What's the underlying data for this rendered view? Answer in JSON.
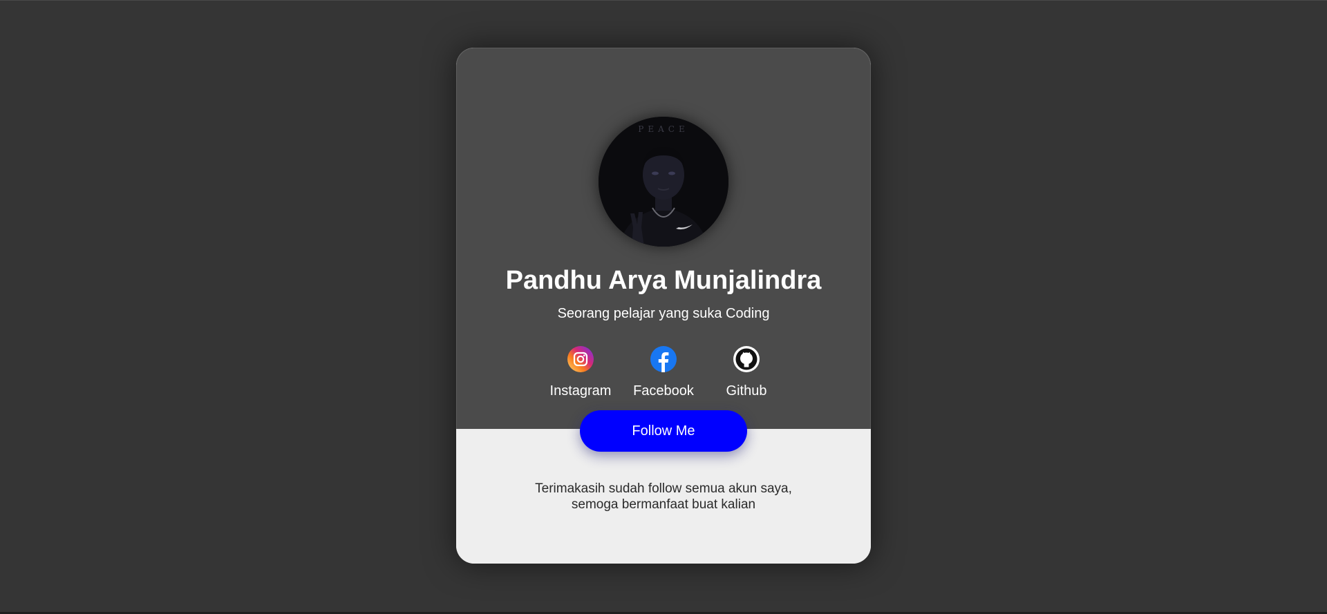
{
  "profile": {
    "name": "Pandhu Arya Munjalindra",
    "bio": "Seorang pelajar yang suka Coding",
    "avatar_text": "PEACE"
  },
  "socials": [
    {
      "label": "Instagram",
      "icon": "instagram-icon"
    },
    {
      "label": "Facebook",
      "icon": "facebook-icon"
    },
    {
      "label": "Github",
      "icon": "github-icon"
    }
  ],
  "follow_button": {
    "label": "Follow Me"
  },
  "message": {
    "line1": "Terimakasih sudah follow semua akun saya,",
    "line2": "semoga bermanfaat buat kalian"
  },
  "colors": {
    "background": "#353535",
    "card_top": "#4b4b4b",
    "card_bottom": "#eeeeee",
    "accent": "#0000ff",
    "facebook": "#1877f2"
  }
}
